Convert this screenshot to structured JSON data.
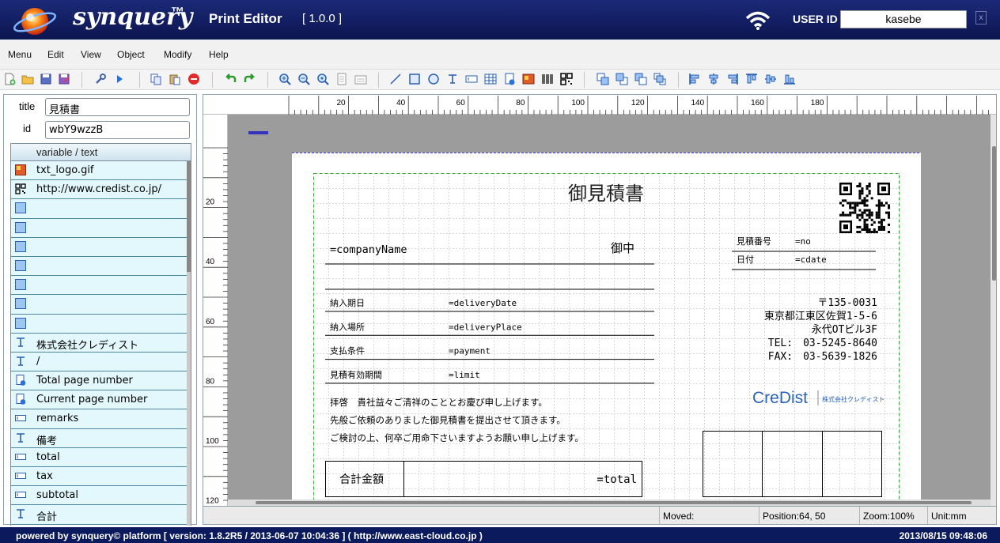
{
  "header": {
    "brand": "synquery",
    "brand_tm": "™",
    "app_title": "Print Editor",
    "version": "[ 1.0.0 ]",
    "user_id_label": "USER ID",
    "user_id_value": "kasebe",
    "close_glyph": "x",
    "accent_color": "#1b2a78"
  },
  "menu": [
    "Menu",
    "Edit",
    "View",
    "Object",
    "Modify",
    "Help"
  ],
  "left_panel": {
    "title_label": "title",
    "title_value": "見積書",
    "id_label": "id",
    "id_value": "wbY9wzzB",
    "table_header": "variable / text",
    "rows": [
      {
        "icon": "image-icon",
        "text": "txt_logo.gif"
      },
      {
        "icon": "qrcode-icon",
        "text": "http://www.credist.co.jp/"
      },
      {
        "icon": "rectangle-icon",
        "text": ""
      },
      {
        "icon": "rectangle-icon",
        "text": ""
      },
      {
        "icon": "rectangle-icon",
        "text": ""
      },
      {
        "icon": "rectangle-icon",
        "text": ""
      },
      {
        "icon": "rectangle-icon",
        "text": ""
      },
      {
        "icon": "rectangle-icon",
        "text": ""
      },
      {
        "icon": "rectangle-icon",
        "text": ""
      },
      {
        "icon": "text-icon",
        "text": "株式会社クレディスト"
      },
      {
        "icon": "text-icon",
        "text": "/"
      },
      {
        "icon": "page-number-icon",
        "text": "Total page number"
      },
      {
        "icon": "page-number-icon",
        "text": "Current page number"
      },
      {
        "icon": "variable-field-icon",
        "text": "remarks"
      },
      {
        "icon": "text-icon",
        "text": "備考"
      },
      {
        "icon": "variable-field-icon",
        "text": "total"
      },
      {
        "icon": "variable-field-icon",
        "text": "tax"
      },
      {
        "icon": "variable-field-icon",
        "text": "subtotal"
      },
      {
        "icon": "text-icon",
        "text": "合計"
      }
    ]
  },
  "rulers": {
    "top_labels": [
      "20",
      "40",
      "60",
      "80",
      "100",
      "120",
      "140",
      "160",
      "180"
    ],
    "left_labels": [
      "20",
      "40",
      "60",
      "80",
      "100",
      "120"
    ]
  },
  "document": {
    "title": "御見積書",
    "company_var": "=companyName",
    "honorific": "御中",
    "estimate_no_label": "見積番号",
    "estimate_no_var": "=no",
    "date_label": "日付",
    "date_var": "=cdate",
    "fields": [
      {
        "label": "納入期日",
        "var": "=deliveryDate"
      },
      {
        "label": "納入場所",
        "var": "=deliveryPlace"
      },
      {
        "label": "支払条件",
        "var": "=payment"
      },
      {
        "label": "見積有効期間",
        "var": "=limit"
      }
    ],
    "address": [
      "〒135-0031",
      "東京都江東区佐賀1-5-6",
      "永代OTビル3F",
      "TEL:　03-5245-8640",
      "FAX:　03-5639-1826"
    ],
    "logo_text": "CreDist",
    "logo_sub": "株式会社クレディスト",
    "greeting": [
      "拝啓　貴社益々ご清祥のこととお慶び申し上げます。",
      "先般ご依頼のありました御見積書を提出させて頂きます。",
      "ご検討の上、何卒ご用命下さいますようお願い申し上げます。"
    ],
    "total_label": "合計金額",
    "total_var": "=total"
  },
  "status": {
    "moved": "Moved:",
    "position": "Position:64, 50",
    "zoom": "Zoom:100%",
    "unit": "Unit:mm"
  },
  "footer": {
    "left": "powered by synquery© platform [ version: 1.8.2R5 / 2013-06-07 10:04:36 ] ( http://www.east-cloud.co.jp )",
    "right": "2013/08/15 09:48:06"
  }
}
